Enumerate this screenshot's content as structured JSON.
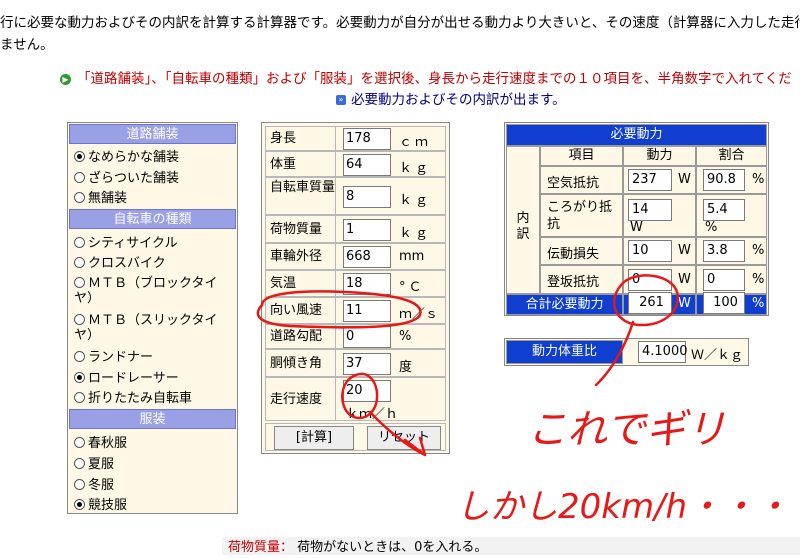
{
  "intro": {
    "line1": "行に必要な動力およびその内訳を計算する計算器です。必要動力が自分が出せる動力より大きいと、その速度（計算器に入力した走行",
    "line2": "ません。"
  },
  "instructions": {
    "line1": "「道路舗装」、「自転車の種類」および「服装」を選択後、身長から走行速度までの１０項目を、半角数字で入れてくだ",
    "line2": "必要動力およびその内訳が出ます。"
  },
  "road": {
    "title": "道路舗装",
    "options": [
      "なめらかな舗装",
      "ざらついた舗装",
      "無舗装"
    ],
    "selected": 0
  },
  "bike": {
    "title": "自転車の種類",
    "options": [
      "シティサイクル",
      "クロスバイク",
      "ＭＴＢ（ブロックタイヤ）",
      "ＭＴＢ（スリックタイヤ）",
      "ランドナー",
      "ロードレーサー",
      "折りたたみ自転車"
    ],
    "selected": 5
  },
  "clothing": {
    "title": "服装",
    "options": [
      "春秋服",
      "夏服",
      "冬服",
      "競技服"
    ],
    "selected": 3
  },
  "inputs": [
    {
      "label": "身長",
      "value": "178",
      "unit": "ｃｍ"
    },
    {
      "label": "体重",
      "value": "64",
      "unit": "ｋｇ"
    },
    {
      "label": "自転車質量",
      "value": "8",
      "unit": "ｋｇ"
    },
    {
      "label": "荷物質量",
      "value": "1",
      "unit": "ｋｇ"
    },
    {
      "label": "車輪外径",
      "value": "668",
      "unit": "mm"
    },
    {
      "label": "気温",
      "value": "18",
      "unit": "°Ｃ"
    },
    {
      "label": "向い風速",
      "value": "11",
      "unit": "ｍ／ｓ"
    },
    {
      "label": "道路勾配",
      "value": "0",
      "unit": "%"
    },
    {
      "label": "胴傾き角",
      "value": "37",
      "unit": "度"
    },
    {
      "label": "走行速度",
      "value": "20",
      "unit": "ｋｍ／ｈ"
    }
  ],
  "buttons": {
    "calc": "[計算]",
    "reset": "リセット"
  },
  "result": {
    "title": "必要動力",
    "col_item": "項目",
    "col_power": "動力",
    "col_ratio": "割合",
    "breakdown_label": "内訳",
    "rows": [
      {
        "item": "空気抵抗",
        "power": "237",
        "ratio": "90.8"
      },
      {
        "item": "ころがり抵抗",
        "power": "14",
        "ratio": "5.4"
      },
      {
        "item": "伝動損失",
        "power": "10",
        "ratio": "3.8"
      },
      {
        "item": "登坂抵抗",
        "power": "0",
        "ratio": "0"
      }
    ],
    "total_label": "合計必要動力",
    "total_power": "261",
    "total_ratio": "100",
    "unit_w": "W",
    "unit_pct": "%"
  },
  "power_weight": {
    "label": "動力体重比",
    "value": "4.1000",
    "unit": "Ｗ／ｋｇ"
  },
  "note": {
    "key": "荷物質量：",
    "text": "荷物がないときは、0を入れる。"
  },
  "handwriting": {
    "line1": "これでギリ",
    "line2": "しかし20km/h・・・・"
  },
  "colors": {
    "header_blue": "#0f3ed0",
    "panel_cream": "#fff8e6",
    "section_lavender": "#9aa0e6",
    "ink_red": "#e81818"
  }
}
